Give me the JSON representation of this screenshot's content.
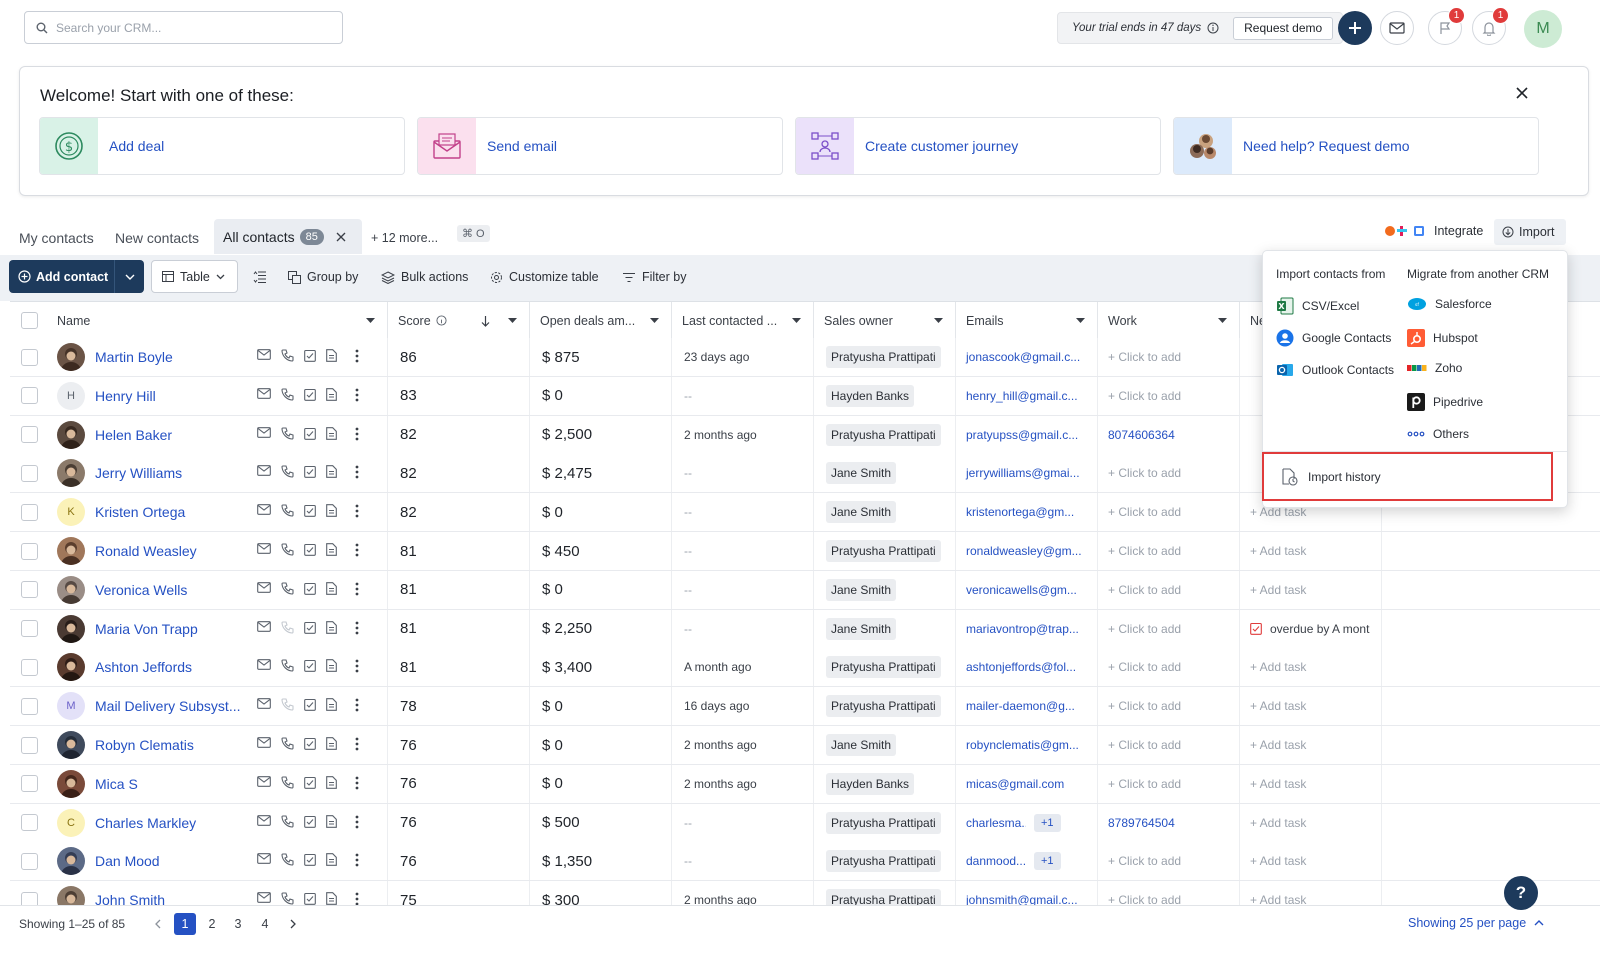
{
  "header": {
    "search_placeholder": "Search your CRM...",
    "trial_text": "Your trial ends in 47 days",
    "request_demo": "Request demo",
    "deals_badge": "1",
    "notif_badge": "1",
    "avatar_initial": "M"
  },
  "welcome": {
    "title": "Welcome! Start with one of these:",
    "cards": [
      "Add deal",
      "Send email",
      "Create customer journey",
      "Need help? Request demo"
    ]
  },
  "tabs": {
    "my_contacts": "My contacts",
    "new_contacts": "New contacts",
    "all_contacts": "All contacts",
    "all_count": "85",
    "more": "+ 12 more...",
    "shortcut": "⌘ O",
    "integrate": "Integrate",
    "import": "Import"
  },
  "toolbar": {
    "add_contact": "Add contact",
    "table": "Table",
    "group_by": "Group by",
    "bulk_actions": "Bulk actions",
    "customize_table": "Customize table",
    "filter_by": "Filter by"
  },
  "columns": {
    "name": "Name",
    "score": "Score",
    "open_deals": "Open deals am...",
    "last_contacted": "Last contacted ...",
    "sales_owner": "Sales owner",
    "emails": "Emails",
    "work": "Work",
    "next": "Ne"
  },
  "rows": [
    {
      "name": "Martin Boyle",
      "initial": "",
      "score": "86",
      "deal": "$ 875",
      "last": "23 days ago",
      "owner": "Pratyusha Prattipati",
      "email": "jonascook@gmail.c...",
      "extra": "",
      "work": "+ Click to add",
      "task": ""
    },
    {
      "name": "Henry Hill",
      "initial": "H",
      "score": "83",
      "deal": "$ 0",
      "last": "--",
      "owner": "Hayden Banks",
      "email": "henry_hill@gmail.c...",
      "extra": "",
      "work": "+ Click to add",
      "task": ""
    },
    {
      "name": "Helen Baker",
      "initial": "",
      "score": "82",
      "deal": "$ 2,500",
      "last": "2 months ago",
      "owner": "Pratyusha Prattipati",
      "email": "pratyupss@gmail.c...",
      "extra": "",
      "work": "8074606364",
      "task": ""
    },
    {
      "name": "Jerry Williams",
      "initial": "",
      "score": "82",
      "deal": "$ 2,475",
      "last": "--",
      "owner": "Jane Smith",
      "email": "jerrywilliams@gmai...",
      "extra": "",
      "work": "+ Click to add",
      "task": ""
    },
    {
      "name": "Kristen Ortega",
      "initial": "K",
      "score": "82",
      "deal": "$ 0",
      "last": "--",
      "owner": "Jane Smith",
      "email": "kristenortega@gm...",
      "extra": "",
      "work": "+ Click to add",
      "task": "+ Add task"
    },
    {
      "name": "Ronald Weasley",
      "initial": "",
      "score": "81",
      "deal": "$ 450",
      "last": "--",
      "owner": "Pratyusha Prattipati",
      "email": "ronaldweasley@gm...",
      "extra": "",
      "work": "+ Click to add",
      "task": "+ Add task"
    },
    {
      "name": "Veronica Wells",
      "initial": "",
      "score": "81",
      "deal": "$ 0",
      "last": "--",
      "owner": "Jane Smith",
      "email": "veronicawells@gm...",
      "extra": "",
      "work": "+ Click to add",
      "task": "+ Add task"
    },
    {
      "name": "Maria Von Trapp",
      "initial": "",
      "score": "81",
      "deal": "$ 2,250",
      "last": "--",
      "owner": "Jane Smith",
      "email": "mariavontrop@trap...",
      "extra": "",
      "work": "+ Click to add",
      "task": "overdue by A mont"
    },
    {
      "name": "Ashton Jeffords",
      "initial": "",
      "score": "81",
      "deal": "$ 3,400",
      "last": "A month ago",
      "owner": "Pratyusha Prattipati",
      "email": "ashtonjeffords@fol...",
      "extra": "",
      "work": "+ Click to add",
      "task": "+ Add task"
    },
    {
      "name": "Mail Delivery Subsyst...",
      "initial": "M",
      "score": "78",
      "deal": "$ 0",
      "last": "16 days ago",
      "owner": "Pratyusha Prattipati",
      "email": "mailer-daemon@g...",
      "extra": "",
      "work": "+ Click to add",
      "task": "+ Add task"
    },
    {
      "name": "Robyn Clematis",
      "initial": "",
      "score": "76",
      "deal": "$ 0",
      "last": "2 months ago",
      "owner": "Jane Smith",
      "email": "robynclematis@gm...",
      "extra": "",
      "work": "+ Click to add",
      "task": "+ Add task"
    },
    {
      "name": "Mica S",
      "initial": "",
      "score": "76",
      "deal": "$ 0",
      "last": "2 months ago",
      "owner": "Hayden Banks",
      "email": "micas@gmail.com",
      "extra": "",
      "work": "+ Click to add",
      "task": "+ Add task"
    },
    {
      "name": "Charles Markley",
      "initial": "C",
      "score": "76",
      "deal": "$ 500",
      "last": "--",
      "owner": "Pratyusha Prattipati",
      "email": "charlesma...",
      "extra": "+1",
      "work": "8789764504",
      "task": "+ Add task"
    },
    {
      "name": "Dan Mood",
      "initial": "",
      "score": "76",
      "deal": "$ 1,350",
      "last": "--",
      "owner": "Pratyusha Prattipati",
      "email": "danmood...",
      "extra": "+1",
      "work": "+ Click to add",
      "task": "+ Add task"
    },
    {
      "name": "John Smith",
      "initial": "",
      "score": "75",
      "deal": "$ 300",
      "last": "2 months ago",
      "owner": "Pratyusha Prattipati",
      "email": "johnsmith@gmail.c...",
      "extra": "",
      "work": "+ Click to add",
      "task": "+ Add task"
    }
  ],
  "import_menu": {
    "import_from": "Import contacts from",
    "migrate_from": "Migrate from another CRM",
    "sources": [
      "CSV/Excel",
      "Google Contacts",
      "Outlook Contacts"
    ],
    "crms": [
      "Salesforce",
      "Hubspot",
      "Zoho",
      "Pipedrive",
      "Others"
    ],
    "history": "Import history"
  },
  "footer": {
    "showing": "Showing 1–25 of 85",
    "pages": [
      "1",
      "2",
      "3",
      "4"
    ],
    "per_page": "Showing 25 per page",
    "help": "?"
  }
}
